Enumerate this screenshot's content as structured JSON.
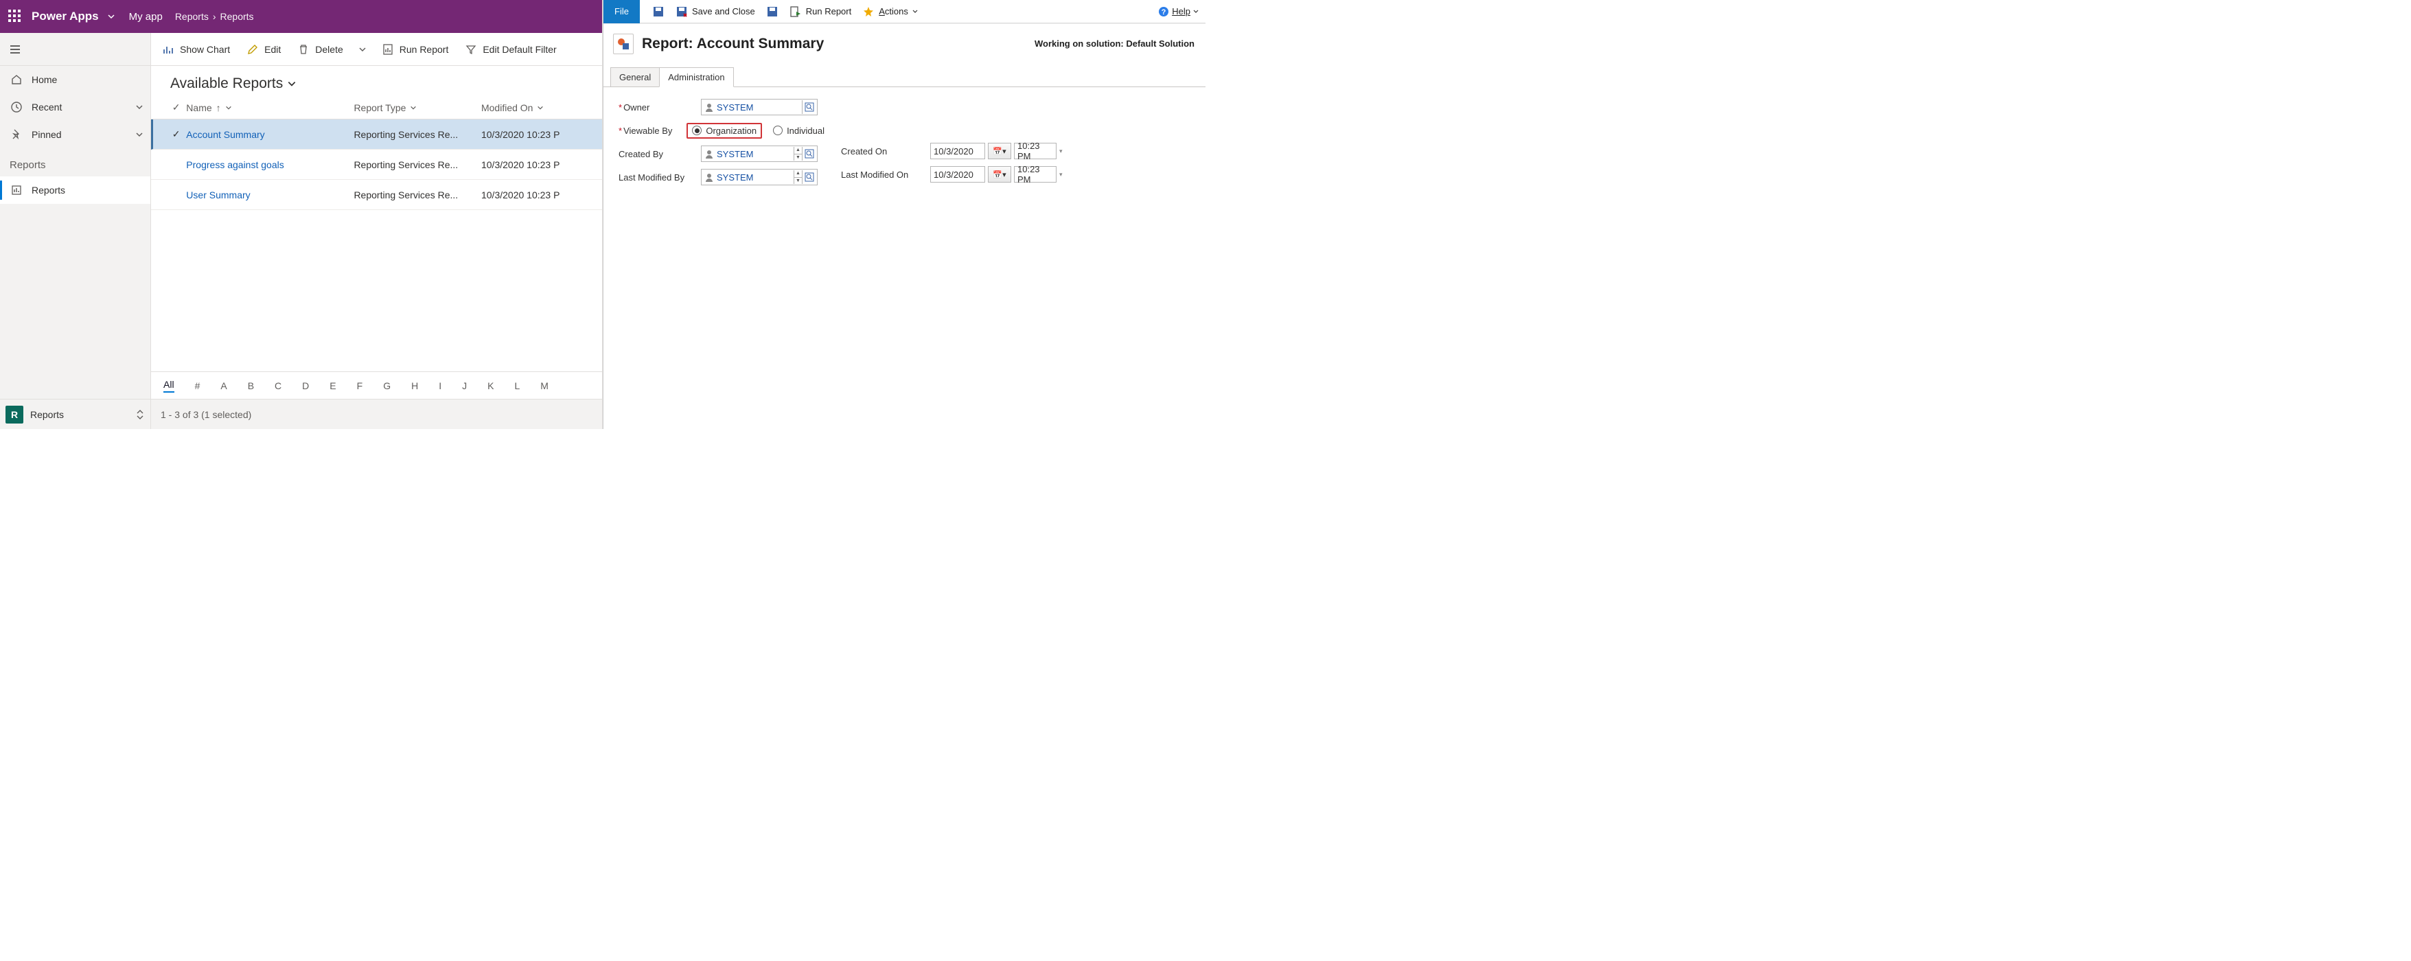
{
  "header": {
    "brand": "Power Apps",
    "app_name": "My app",
    "breadcrumb1": "Reports",
    "breadcrumb2": "Reports"
  },
  "nav": {
    "home": "Home",
    "recent": "Recent",
    "pinned": "Pinned",
    "group": "Reports",
    "reports": "Reports"
  },
  "cmdbar": {
    "show_chart": "Show Chart",
    "edit": "Edit",
    "delete": "Delete",
    "run_report": "Run Report",
    "edit_filter": "Edit Default Filter"
  },
  "view": {
    "title": "Available Reports",
    "cols": {
      "name": "Name",
      "type": "Report Type",
      "modified": "Modified On"
    },
    "rows": [
      {
        "name": "Account Summary",
        "type": "Reporting Services Re...",
        "modified": "10/3/2020 10:23 P",
        "selected": true
      },
      {
        "name": "Progress against goals",
        "type": "Reporting Services Re...",
        "modified": "10/3/2020 10:23 P",
        "selected": false
      },
      {
        "name": "User Summary",
        "type": "Reporting Services Re...",
        "modified": "10/3/2020 10:23 P",
        "selected": false
      }
    ],
    "alpha": [
      "All",
      "#",
      "A",
      "B",
      "C",
      "D",
      "E",
      "F",
      "G",
      "H",
      "I",
      "J",
      "K",
      "L",
      "M"
    ]
  },
  "footer": {
    "badge": "R",
    "area": "Reports",
    "count": "1 - 3 of 3 (1 selected)"
  },
  "ribbon": {
    "file": "File",
    "save_close": "Save and Close",
    "run_report": "Run Report",
    "actions": "Actions",
    "help": "Help"
  },
  "report": {
    "title": "Report: Account Summary",
    "solution": "Working on solution: Default Solution",
    "tabs": {
      "general": "General",
      "admin": "Administration"
    },
    "fields": {
      "owner_label": "Owner",
      "owner_value": "SYSTEM",
      "viewable_label": "Viewable By",
      "viewable_org": "Organization",
      "viewable_ind": "Individual",
      "created_by_label": "Created By",
      "created_by_value": "SYSTEM",
      "modified_by_label": "Last Modified By",
      "modified_by_value": "SYSTEM",
      "created_on_label": "Created On",
      "created_on_date": "10/3/2020",
      "created_on_time": "10:23 PM",
      "modified_on_label": "Last Modified On",
      "modified_on_date": "10/3/2020",
      "modified_on_time": "10:23 PM"
    }
  }
}
